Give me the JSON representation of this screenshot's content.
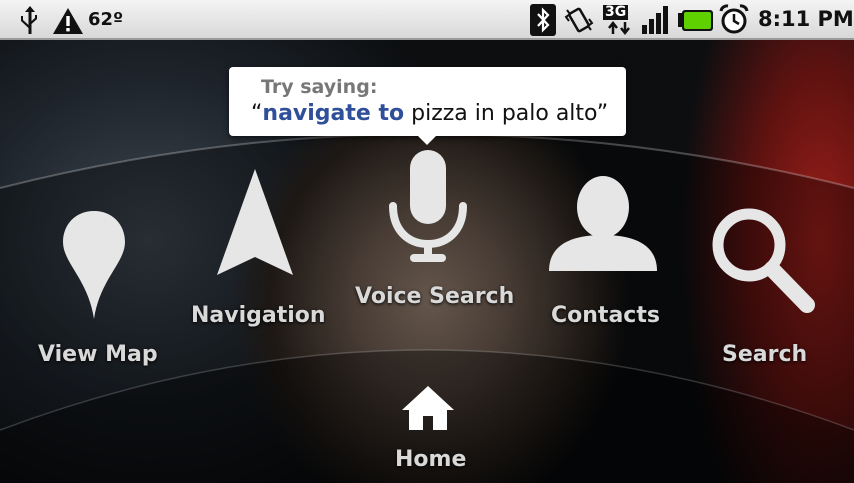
{
  "status_bar": {
    "temperature": "62º",
    "time": "8:11 PM",
    "network_label": "3G",
    "icons": [
      "usb-icon",
      "warning-icon",
      "bluetooth-icon",
      "vibrate-icon",
      "network-3g-icon",
      "signal-icon",
      "battery-icon",
      "alarm-icon"
    ]
  },
  "tooltip": {
    "title": "Try saying:",
    "open_quote": "“",
    "highlight": "navigate to",
    "phrase": " pizza in palo alto",
    "close_quote": "”"
  },
  "launcher": {
    "items": [
      {
        "label": "View Map",
        "icon": "map-pin-icon"
      },
      {
        "label": "Navigation",
        "icon": "navigation-arrow-icon"
      },
      {
        "label": "Voice Search",
        "icon": "microphone-icon"
      },
      {
        "label": "Contacts",
        "icon": "person-icon"
      },
      {
        "label": "Search",
        "icon": "magnifier-icon"
      },
      {
        "label": "Home",
        "icon": "house-icon"
      }
    ]
  },
  "colors": {
    "highlight": "#2f4f9a",
    "icon": "#e6e6e6",
    "label": "#d9d9d9"
  }
}
